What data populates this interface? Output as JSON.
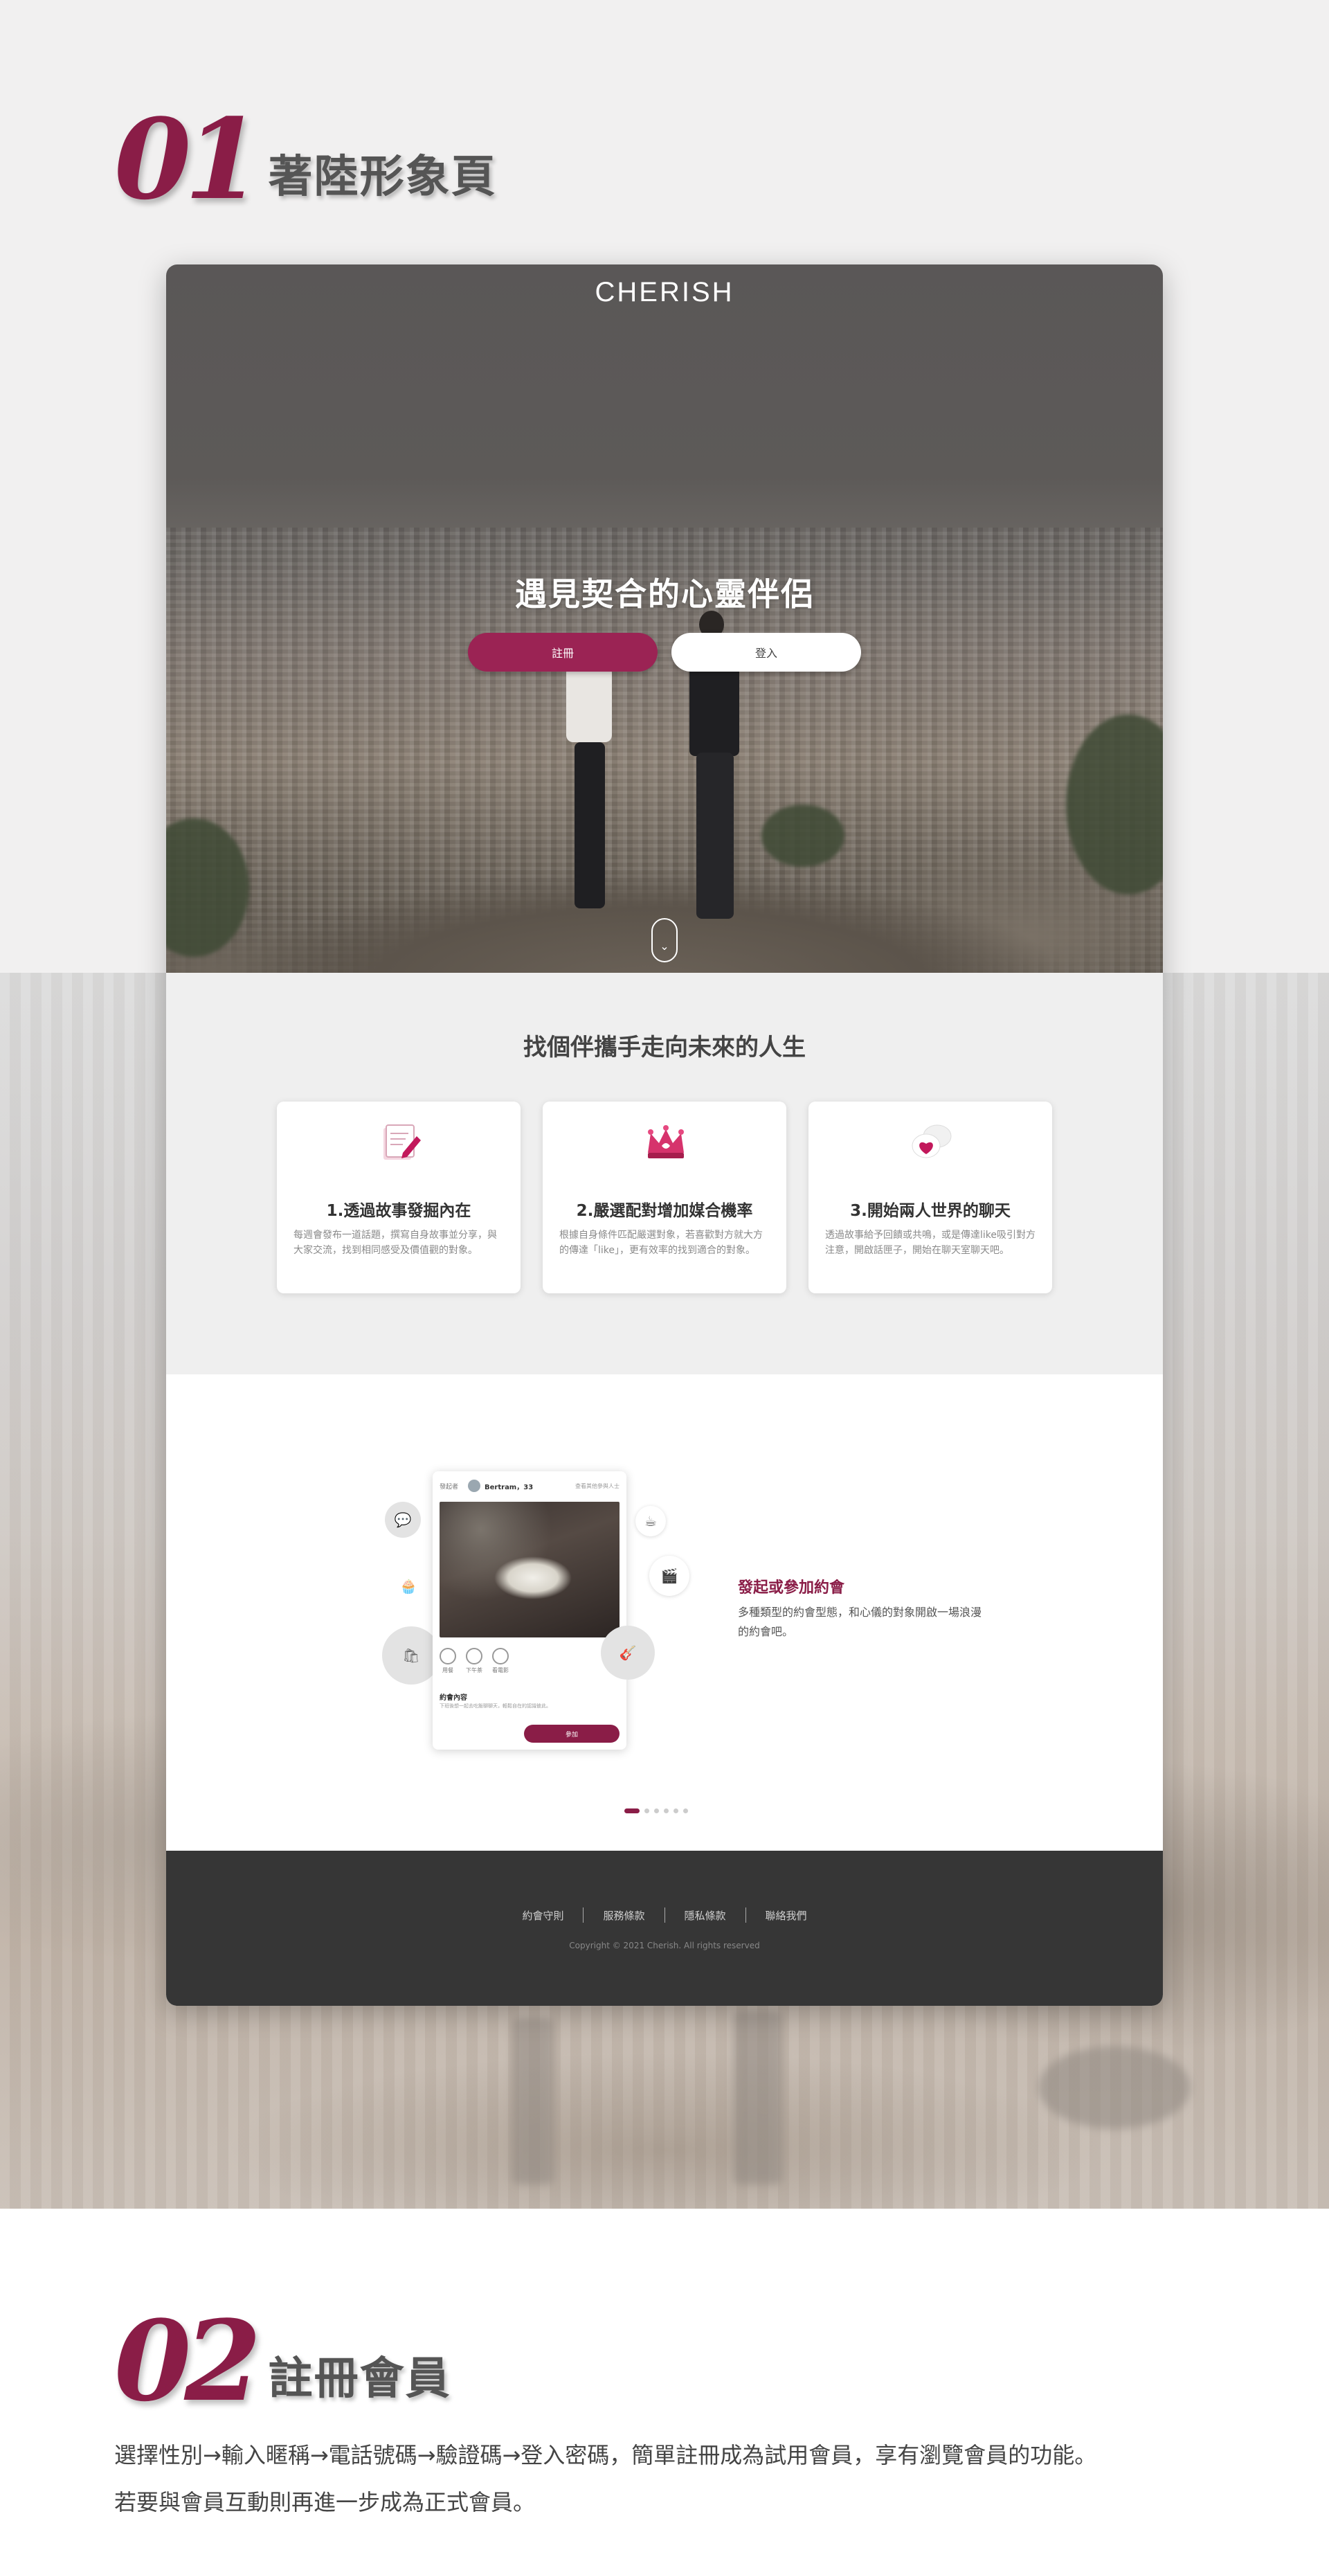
{
  "section1": {
    "number": "01",
    "title": "著陸形象頁"
  },
  "hero": {
    "logo": "CHERISH",
    "headline": "遇見契合的心靈伴侶",
    "register_label": "註冊",
    "login_label": "登入"
  },
  "features": {
    "title": "找個伴攜手走向未來的人生",
    "cards": [
      {
        "icon": "write-icon",
        "title": "1.透過故事發掘內在",
        "desc": "每週會發布一道話題，撰寫自身故事並分享，與大家交流，找到相同感受及價值觀的對象。"
      },
      {
        "icon": "crown-icon",
        "title": "2.嚴選配對增加媒合機率",
        "desc": "根據自身條件匹配嚴選對象，若喜歡對方就大方的傳達「like」，更有效率的找到適合的對象。"
      },
      {
        "icon": "chat-heart-icon",
        "title": "3.開始兩人世界的聊天",
        "desc": "透過故事給予回饋或共鳴，或是傳達like吸引對方注意，開啟話匣子，開始在聊天室聊天吧。"
      }
    ]
  },
  "dating": {
    "title": "發起或參加約會",
    "desc": "多種類型的約會型態，和心儀的對象開啟一場浪漫的約會吧。",
    "phone": {
      "back": "發起者",
      "name": "Bertram，33",
      "link": "查看其他參與人士",
      "icons": [
        "用餐",
        "下午茶",
        "看電影"
      ],
      "content_title": "約會內容",
      "content_text": "下班後想一起去吃飯聊聊天，輕鬆自在的認識彼此。",
      "button": "參加"
    }
  },
  "footer": {
    "links": [
      "約會守則",
      "服務條款",
      "隱私條款",
      "聯絡我們"
    ],
    "copyright": "Copyright © 2021 Cherish. All rights reserved"
  },
  "section2": {
    "number": "02",
    "title": "註冊會員",
    "desc_line1": "選擇性別→輸入暱稱→電話號碼→驗證碼→登入密碼，簡單註冊成為試用會員，享有瀏覽會員的功能。",
    "desc_line2": "若要與會員互動則再進一步成為正式會員。"
  },
  "colors": {
    "brand": "#8a1d47",
    "register": "#9b2354",
    "footer_bg": "#363636"
  }
}
